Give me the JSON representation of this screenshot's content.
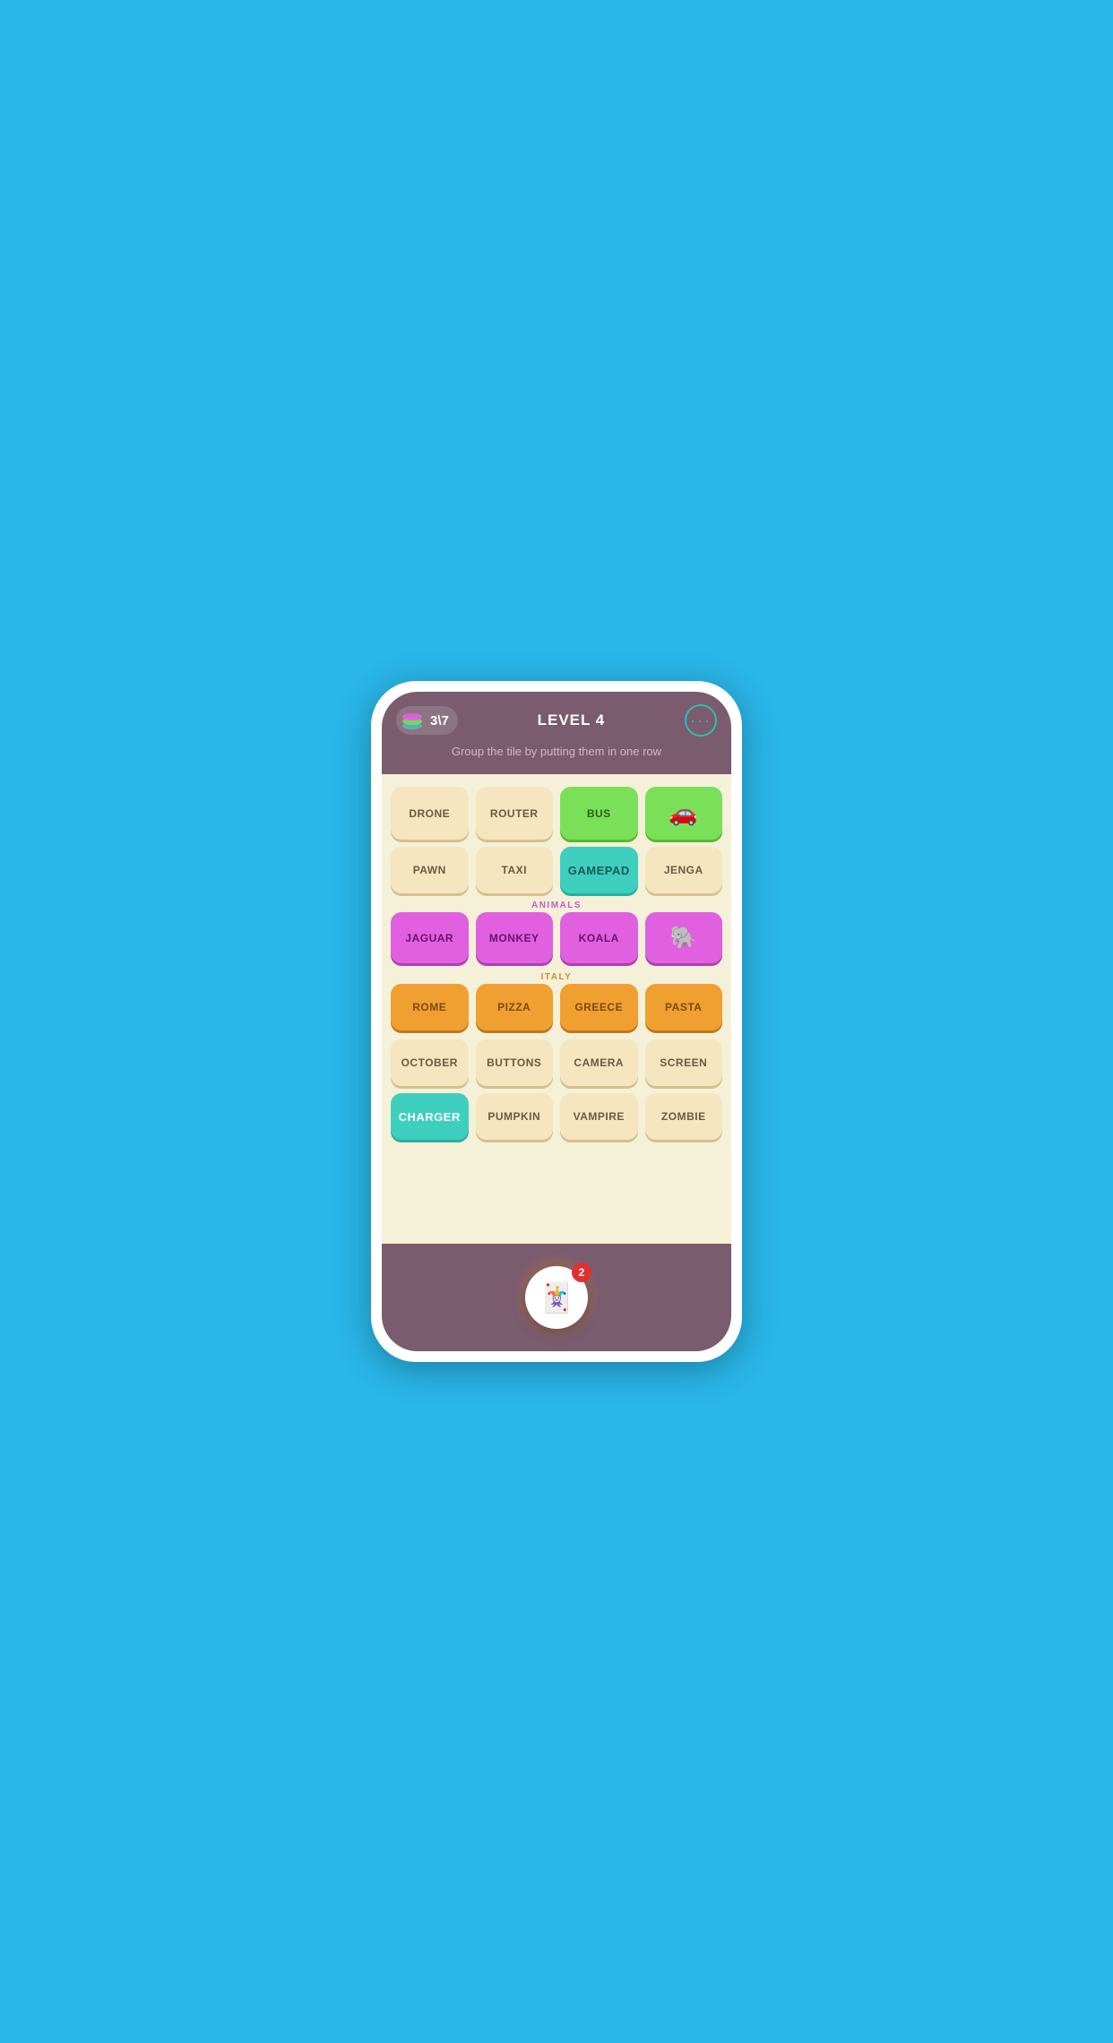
{
  "header": {
    "score": "3\\7",
    "level": "LEVEL 4",
    "instruction": "Group the tile by putting them\nin one row"
  },
  "menu": {
    "dots": "···"
  },
  "rows": {
    "row1": [
      {
        "label": "DRONE",
        "type": "cream"
      },
      {
        "label": "ROUTER",
        "type": "cream"
      },
      {
        "label": "BUS",
        "type": "green"
      },
      {
        "label": "🚗",
        "type": "green",
        "icon": true
      }
    ],
    "row2": [
      {
        "label": "PAWN",
        "type": "cream"
      },
      {
        "label": "TAXI",
        "type": "cream"
      },
      {
        "label": "GAMEPAD",
        "type": "teal"
      },
      {
        "label": "JENGA",
        "type": "cream"
      }
    ],
    "animals_label": "ANIMALS",
    "animals": [
      {
        "label": "JAGUAR",
        "type": "purple"
      },
      {
        "label": "MONKEY",
        "type": "purple"
      },
      {
        "label": "KOALA",
        "type": "purple"
      },
      {
        "label": "🐘",
        "type": "purple",
        "icon": true
      }
    ],
    "italy_label": "ITALY",
    "italy": [
      {
        "label": "ROME",
        "type": "orange"
      },
      {
        "label": "PIZZA",
        "type": "orange"
      },
      {
        "label": "GREECE",
        "type": "orange"
      },
      {
        "label": "PASTA",
        "type": "orange"
      }
    ],
    "row5": [
      {
        "label": "OCTOBER",
        "type": "cream"
      },
      {
        "label": "BUTTONS",
        "type": "cream"
      },
      {
        "label": "CAMERA",
        "type": "cream"
      },
      {
        "label": "SCREEN",
        "type": "cream"
      }
    ],
    "row6": [
      {
        "label": "CHARGER",
        "type": "teal-selected"
      },
      {
        "label": "PUMPKIN",
        "type": "cream"
      },
      {
        "label": "VAMPIRE",
        "type": "cream"
      },
      {
        "label": "ZOMBIE",
        "type": "cream"
      }
    ]
  },
  "hint": {
    "count": "2",
    "icon": "🃏"
  }
}
